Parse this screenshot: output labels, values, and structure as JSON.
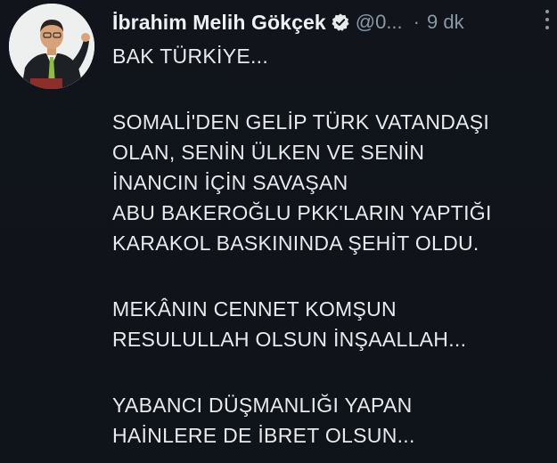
{
  "tweet": {
    "author_name": "İbrahim Melih Gökçek",
    "handle": "@0...",
    "separator": "·",
    "time": "9 dk",
    "paragraphs": [
      [
        "BAK TÜRKİYE..."
      ],
      [
        "SOMALİ'DEN GELİP TÜRK VATANDAŞI",
        "OLAN, SENİN ÜLKEN VE SENİN",
        "İNANCIN İÇİN SAVAŞAN",
        "ABU BAKEROĞLU PKK'LARIN YAPTIĞI",
        "KARAKOL BASKININDA ŞEHİT OLDU."
      ],
      [
        "MEKÂNIN CENNET KOMŞUN",
        "RESULULLAH OLSUN İNŞAALLAH..."
      ],
      [
        "YABANCI DÜŞMANLIĞI YAPAN",
        "HAİNLERE DE İBRET OLSUN..."
      ]
    ]
  },
  "icons": {
    "verified": "verified-badge-icon",
    "more": "more-options-icon"
  },
  "colors": {
    "background": "#0d1117",
    "text": "#e7e9ea",
    "secondary_text": "#8b98a5",
    "verified_badge": "#e7e9ea"
  }
}
